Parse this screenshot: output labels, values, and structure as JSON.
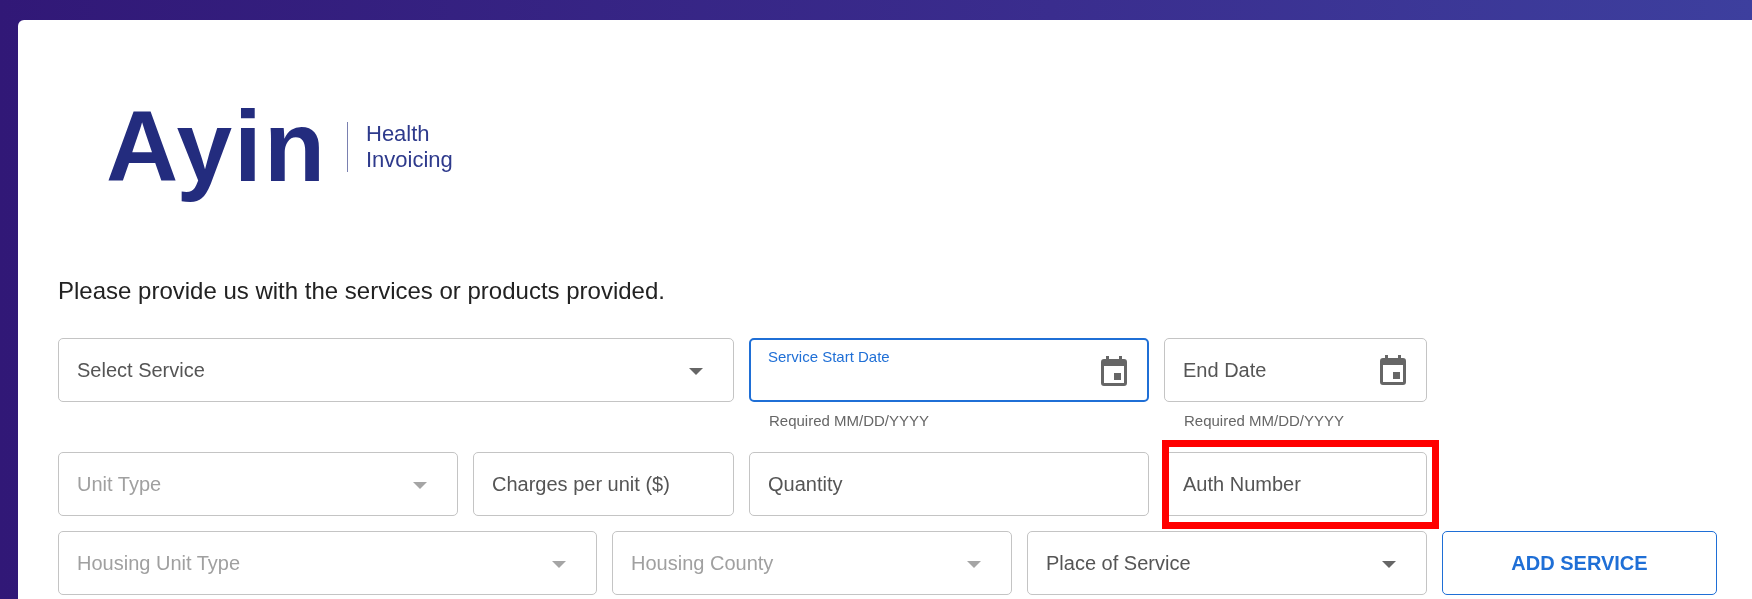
{
  "logo": {
    "wordmark": "Ayin",
    "tagline": [
      "Health",
      "Invoicing"
    ]
  },
  "prompt": "Please provide us with the services or products provided.",
  "rows": [
    [
      {
        "kind": "select",
        "label": "Select Service",
        "disabled": false
      },
      {
        "kind": "date",
        "label": "Service Start Date",
        "focused": true,
        "helper": "Required MM/DD/YYYY"
      },
      {
        "kind": "date",
        "label": "End Date",
        "focused": false,
        "helper": "Required MM/DD/YYYY"
      }
    ],
    [
      {
        "kind": "select",
        "label": "Unit Type",
        "disabled": true
      },
      {
        "kind": "text",
        "label": "Charges per unit ($)",
        "highlighted": false
      },
      {
        "kind": "text",
        "label": "Quantity",
        "highlighted": false
      },
      {
        "kind": "text",
        "label": "Auth Number",
        "highlighted": true
      }
    ],
    [
      {
        "kind": "select",
        "label": "Housing Unit Type",
        "disabled": true
      },
      {
        "kind": "select",
        "label": "Housing County",
        "disabled": true
      },
      {
        "kind": "select",
        "label": "Place of Service",
        "disabled": false
      },
      {
        "kind": "button",
        "label": "ADD SERVICE"
      }
    ]
  ]
}
